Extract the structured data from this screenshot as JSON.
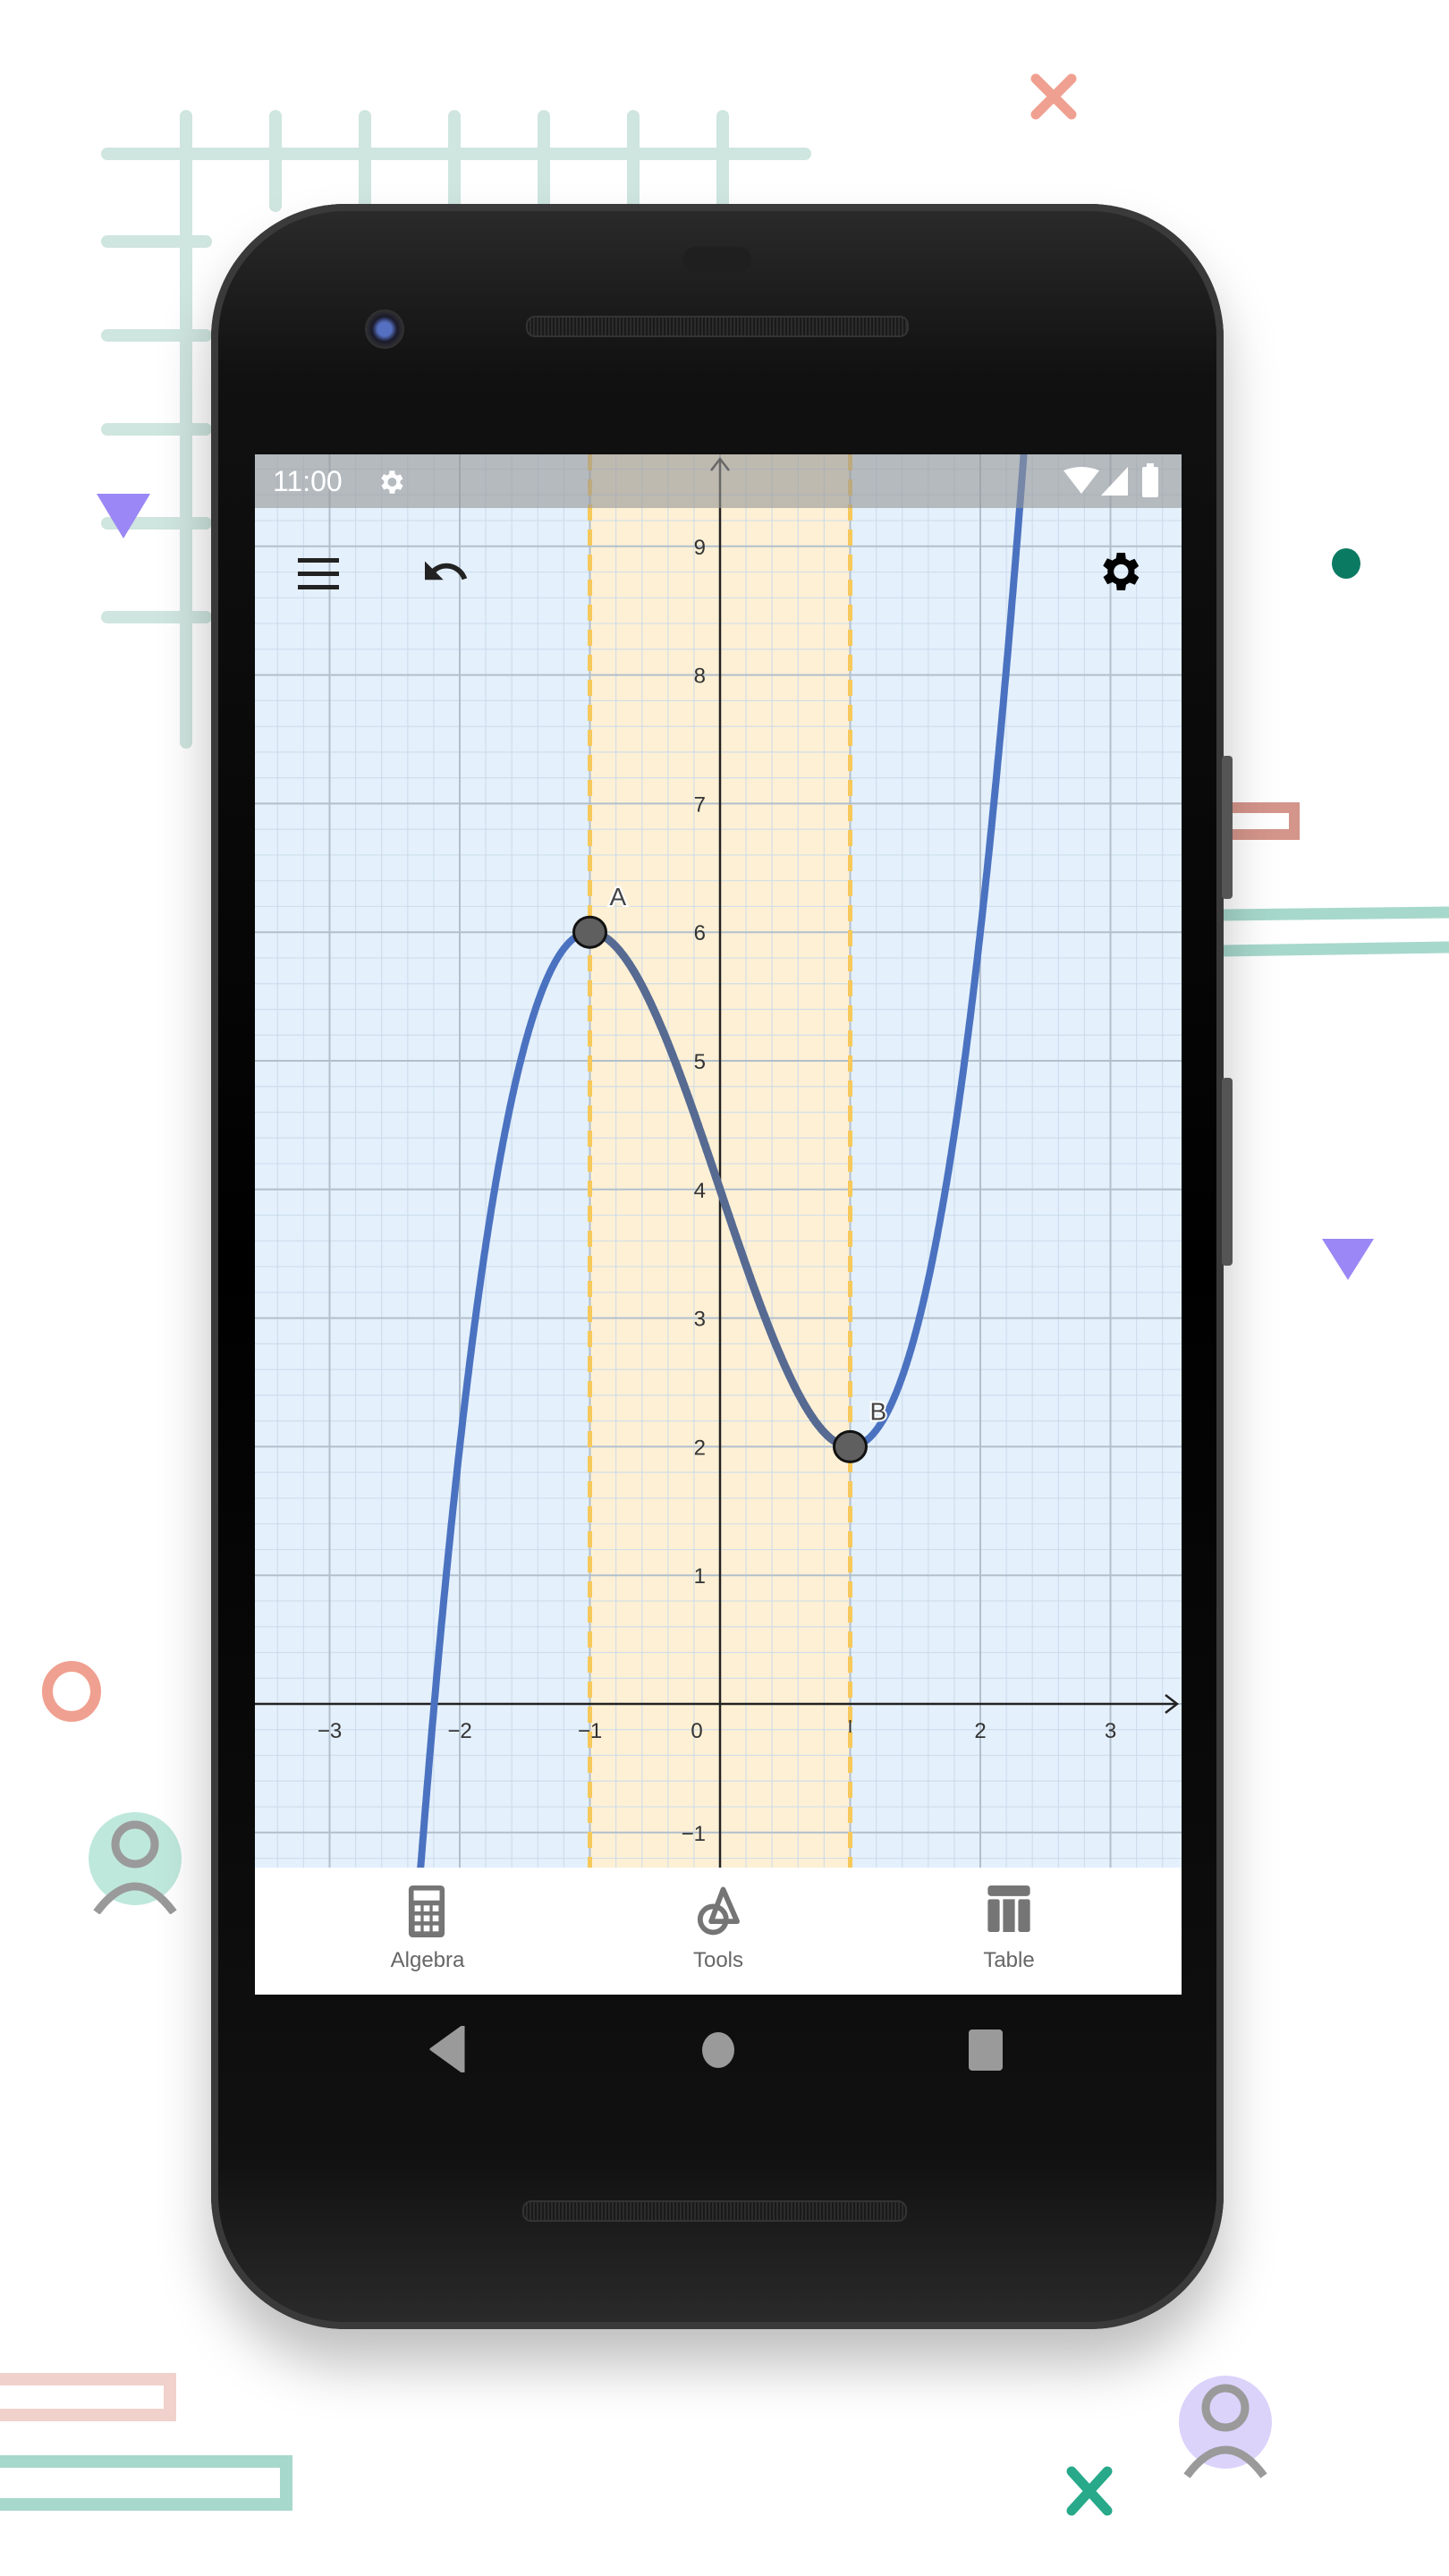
{
  "status_bar": {
    "time": "11:00",
    "icons": [
      "settings-gear-icon",
      "wifi-icon",
      "cellular-signal-icon",
      "battery-icon"
    ]
  },
  "toolbar": {
    "menu_icon": "hamburger-menu-icon",
    "undo_icon": "undo-icon",
    "settings_icon": "gear-icon"
  },
  "bottom_tabs": [
    {
      "label": "Algebra",
      "icon": "calculator-icon"
    },
    {
      "label": "Tools",
      "icon": "shapes-tool-icon"
    },
    {
      "label": "Table",
      "icon": "table-icon"
    }
  ],
  "nav_bar": {
    "back": "back-triangle-icon",
    "home": "home-circle-icon",
    "recents": "recents-square-icon"
  },
  "colors": {
    "curve": "#4a72c0",
    "curve_highlight": "#566a92",
    "band_fill": "#fdf0d5",
    "band_edge": "#f7c85a",
    "background_grid": "#e4f0fc",
    "point_fill": "#5f5f5f"
  },
  "chart_data": {
    "type": "line",
    "function": "f(x) = x^3 - 3x + 4",
    "x_ticks": [
      "−3",
      "−2",
      "−1",
      "0",
      "1",
      "2",
      "3"
    ],
    "y_ticks": [
      "−1",
      "1",
      "2",
      "3",
      "4",
      "5",
      "6",
      "7",
      "8",
      "9"
    ],
    "xlim": [
      -3.6,
      3.55
    ],
    "ylim": [
      -1.45,
      10.5
    ],
    "grid": true,
    "highlight_band": {
      "x_from": -1,
      "x_to": 1
    },
    "points": [
      {
        "label": "A",
        "x": -1,
        "y": 6
      },
      {
        "label": "B",
        "x": 1,
        "y": 2
      }
    ]
  }
}
